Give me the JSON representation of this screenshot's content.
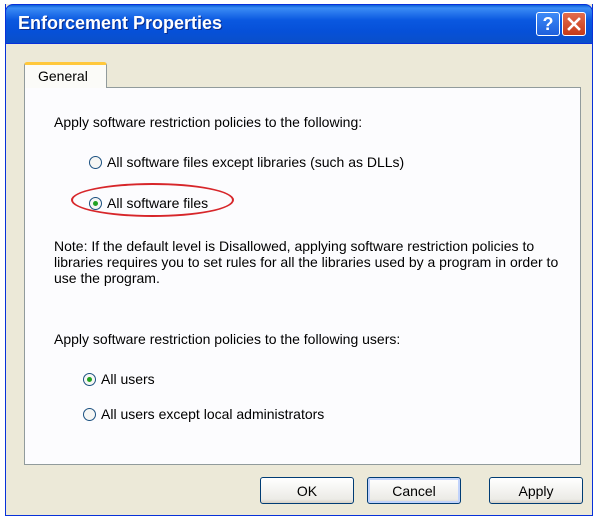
{
  "window": {
    "title": "Enforcement Properties",
    "help_glyph": "?",
    "close_glyph": "✕"
  },
  "tabs": [
    {
      "label": "General",
      "selected": true
    }
  ],
  "section1": {
    "heading": "Apply software restriction policies to the following:",
    "options": [
      {
        "label": "All software files except libraries (such as DLLs)",
        "selected": false
      },
      {
        "label": "All software files",
        "selected": true
      }
    ]
  },
  "note": "Note:  If the default level is Disallowed, applying software restriction policies to libraries requires you to set rules for all the libraries used by a program in order to use the program.",
  "section2": {
    "heading": "Apply software restriction policies to the following users:",
    "options": [
      {
        "label": "All users",
        "selected": true
      },
      {
        "label": "All users except local administrators",
        "selected": false
      }
    ]
  },
  "buttons": {
    "ok": "OK",
    "cancel": "Cancel",
    "apply": "Apply"
  },
  "colors": {
    "title_bar": "#0a58e0",
    "highlight_ellipse": "#d7262a",
    "radio_dot": "#21a121"
  }
}
